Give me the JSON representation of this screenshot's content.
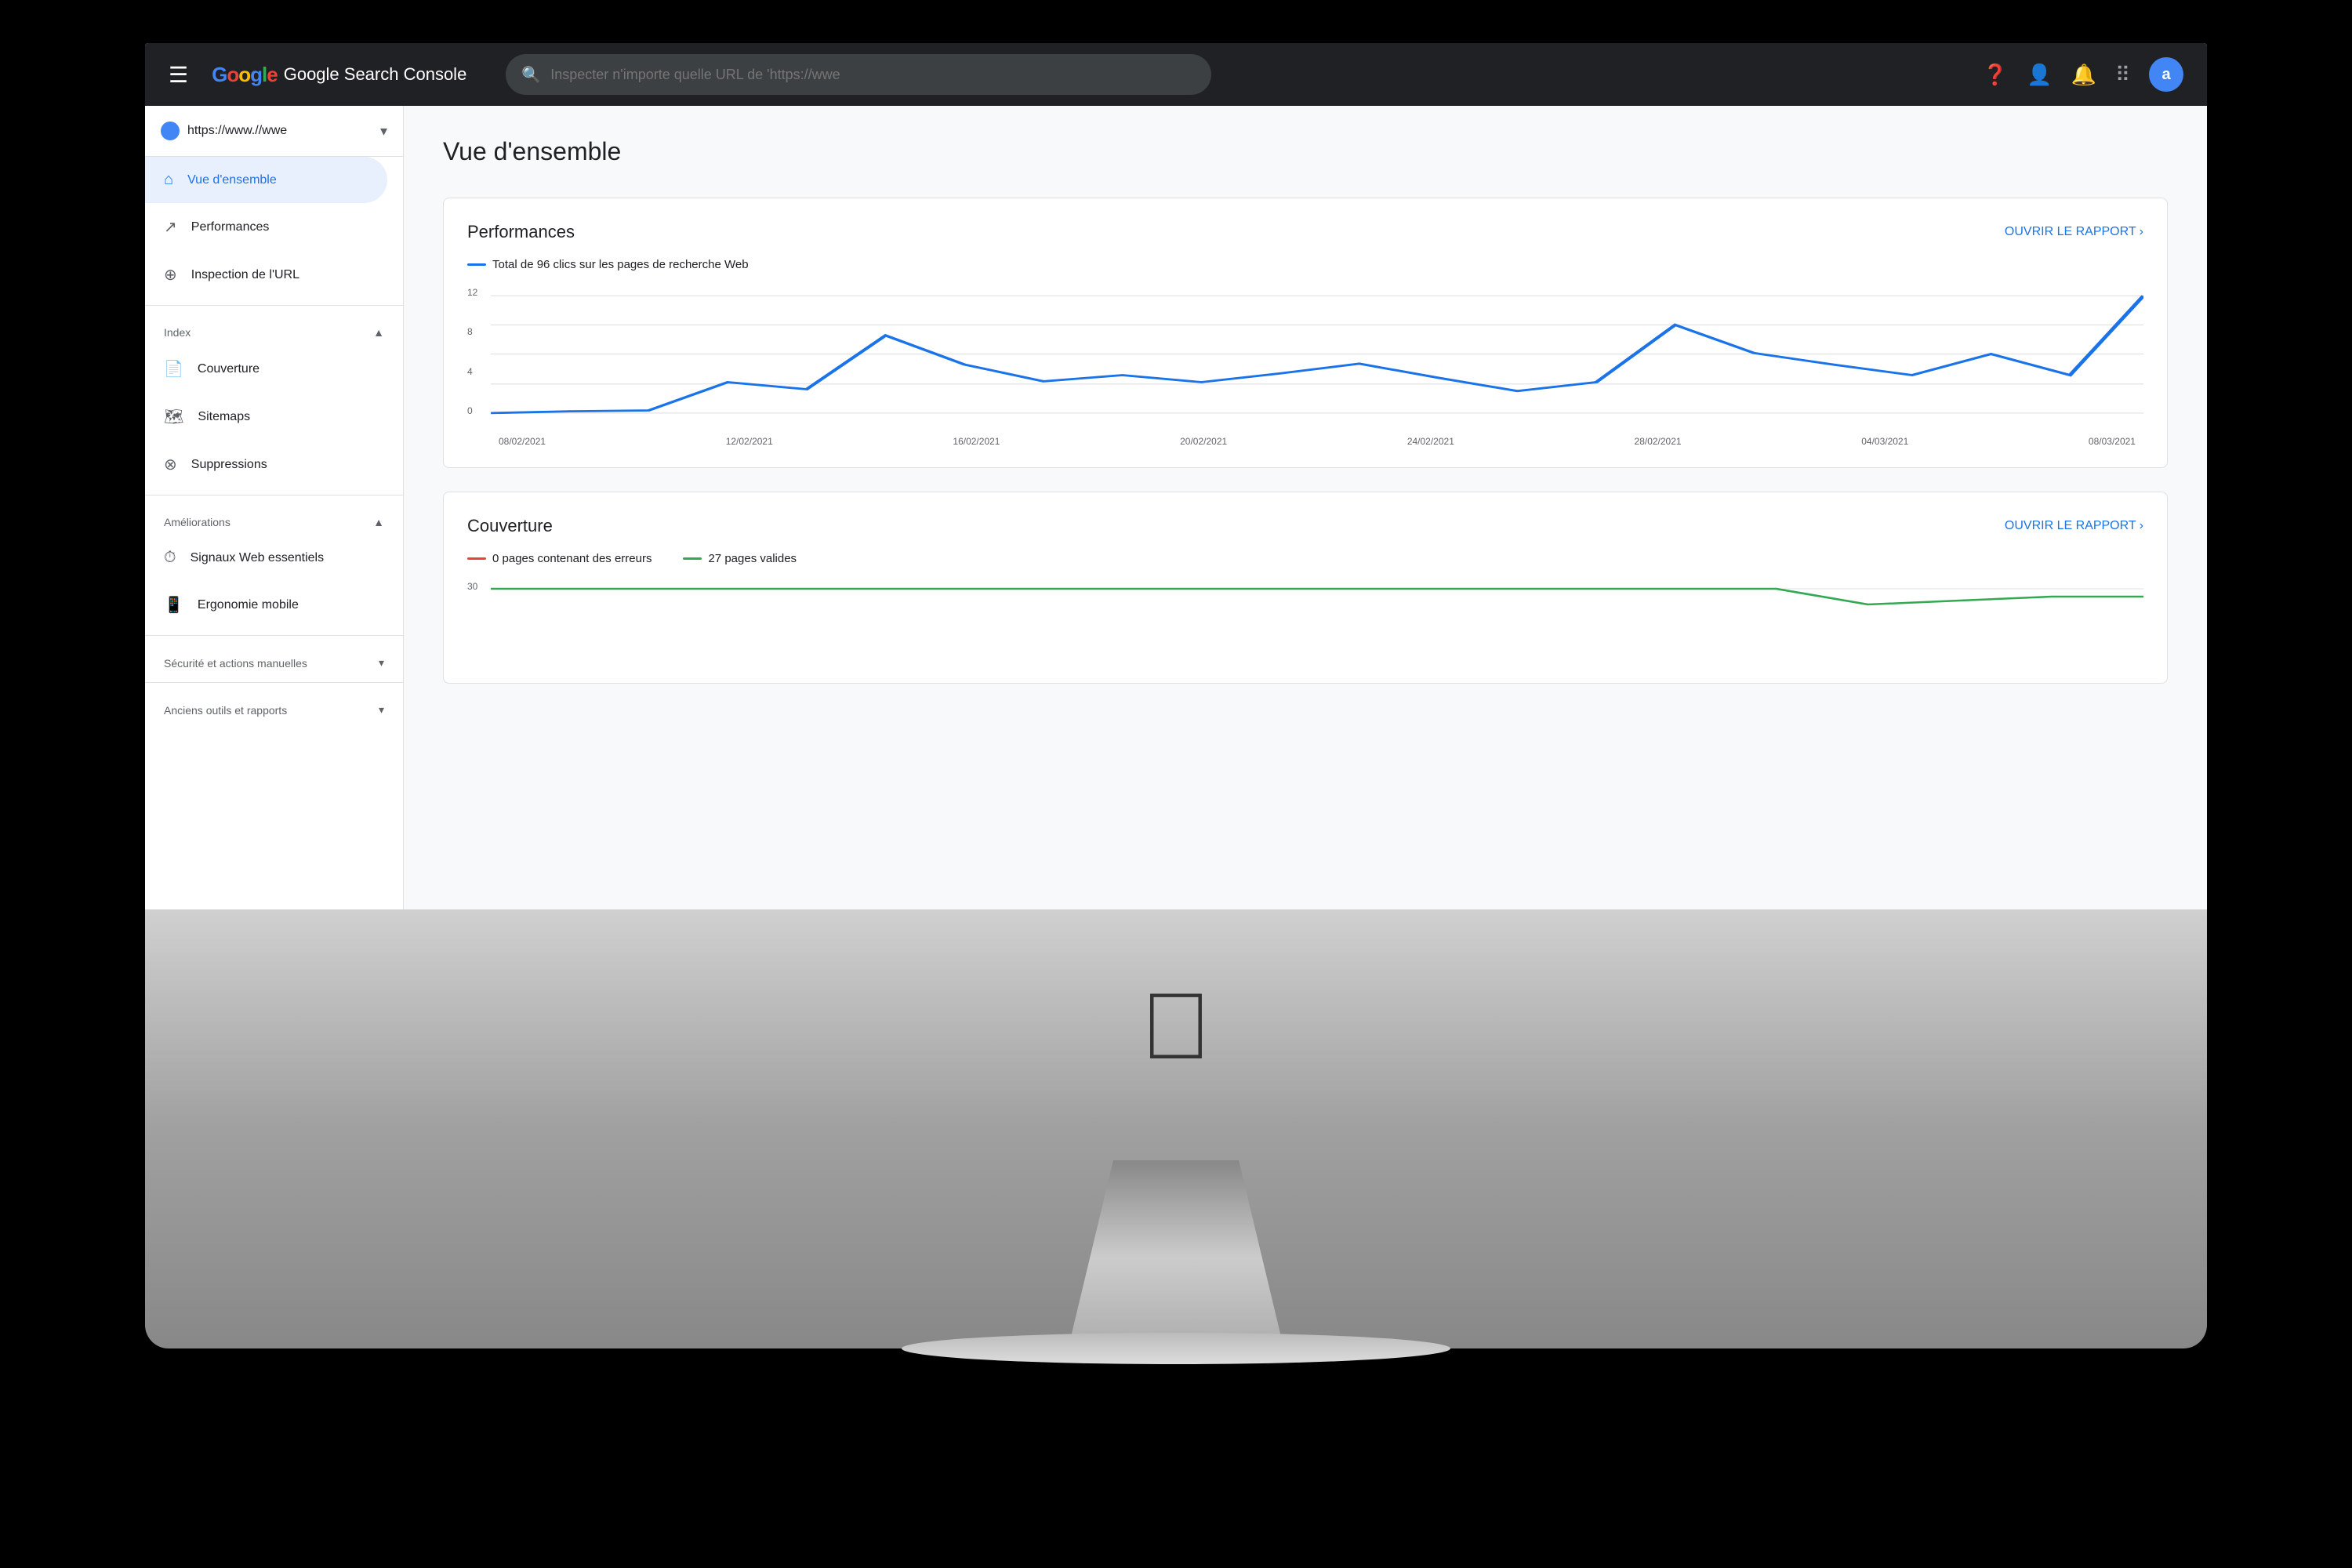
{
  "app": {
    "title": "Google Search Console",
    "logo_text": "Google Search Console"
  },
  "topbar": {
    "search_placeholder": "Inspecter n'importe quelle URL de 'https://wwe",
    "avatar_letter": "a"
  },
  "sidebar": {
    "site_url": "https://www.//wwe",
    "nav_items": [
      {
        "id": "vue-ensemble",
        "label": "Vue d'ensemble",
        "icon": "🏠",
        "active": true
      },
      {
        "id": "performances",
        "label": "Performances",
        "icon": "↗"
      },
      {
        "id": "inspection-url",
        "label": "Inspection de l'URL",
        "icon": "🔍"
      }
    ],
    "sections": [
      {
        "id": "index",
        "label": "Index",
        "items": [
          {
            "id": "couverture",
            "label": "Couverture",
            "icon": "📄"
          },
          {
            "id": "sitemaps",
            "label": "Sitemaps",
            "icon": "📊"
          },
          {
            "id": "suppressions",
            "label": "Suppressions",
            "icon": "🚫"
          }
        ]
      },
      {
        "id": "ameliorations",
        "label": "Améliorations",
        "items": [
          {
            "id": "signaux-web",
            "label": "Signaux Web essentiels",
            "icon": "⏱"
          },
          {
            "id": "ergonomie-mobile",
            "label": "Ergonomie mobile",
            "icon": "📱"
          }
        ]
      },
      {
        "id": "securite",
        "label": "Sécurité et actions manuelles",
        "items": []
      },
      {
        "id": "anciens-outils",
        "label": "Anciens outils et rapports",
        "items": []
      }
    ]
  },
  "main": {
    "page_title": "Vue d'ensemble",
    "cards": {
      "performances": {
        "title": "Performances",
        "link_label": "OUVRIR LE RAPPORT",
        "legend": "Total de 96 clics sur les pages de recherche Web",
        "chart": {
          "y_labels": [
            "12",
            "8",
            "4",
            "0"
          ],
          "x_labels": [
            "08/02/2021",
            "12/02/2021",
            "16/02/2021",
            "20/02/2021",
            "24/02/2021",
            "28/02/2021",
            "04/03/2021",
            "08/03/2021"
          ],
          "data_points": [
            {
              "x": 0,
              "y": 0
            },
            {
              "x": 1,
              "y": 0.1
            },
            {
              "x": 2,
              "y": 3
            },
            {
              "x": 3,
              "y": 2.5
            },
            {
              "x": 4,
              "y": 8
            },
            {
              "x": 5,
              "y": 5
            },
            {
              "x": 6,
              "y": 3
            },
            {
              "x": 7,
              "y": 4
            },
            {
              "x": 8,
              "y": 4.5
            },
            {
              "x": 9,
              "y": 3
            },
            {
              "x": 10,
              "y": 4
            },
            {
              "x": 11,
              "y": 5
            },
            {
              "x": 12,
              "y": 3.5
            },
            {
              "x": 13,
              "y": 2
            },
            {
              "x": 14,
              "y": 3
            },
            {
              "x": 15,
              "y": 9
            },
            {
              "x": 16,
              "y": 6
            },
            {
              "x": 17,
              "y": 5
            },
            {
              "x": 18,
              "y": 4
            },
            {
              "x": 19,
              "y": 6
            },
            {
              "x": 20,
              "y": 4
            },
            {
              "x": 21,
              "y": 12
            }
          ]
        }
      },
      "couverture": {
        "title": "Couverture",
        "link_label": "OUVRIR LE RAPPORT",
        "legend_errors": "0 pages contenant des erreurs",
        "legend_valid": "27 pages valides",
        "chart_y_label": "30"
      }
    }
  },
  "colors": {
    "primary_blue": "#1a73e8",
    "error_red": "#EA4335",
    "success_green": "#34A853",
    "text_primary": "#202124",
    "text_secondary": "#5f6368"
  }
}
